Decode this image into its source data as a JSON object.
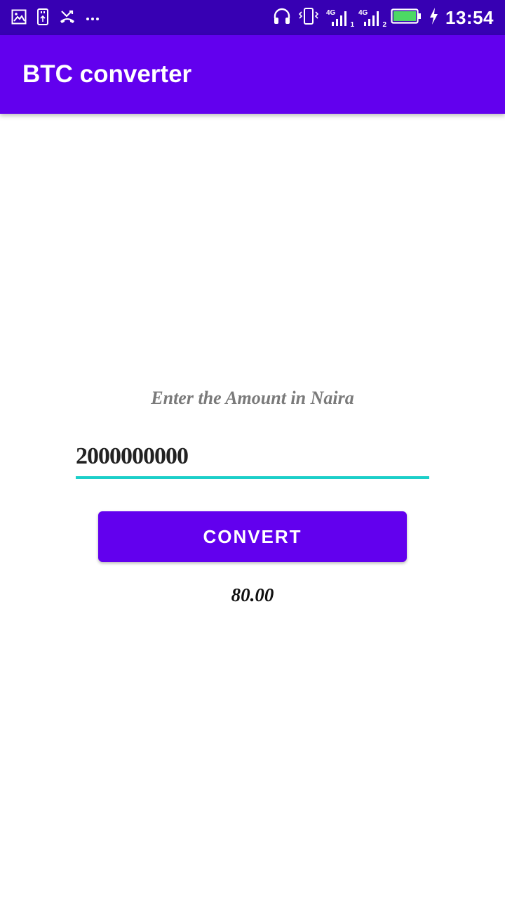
{
  "status_bar": {
    "time": "13:54",
    "network_1": {
      "type": "4G",
      "sim": "1"
    },
    "network_2": {
      "type": "4G",
      "sim": "2"
    },
    "icons": [
      "image-icon",
      "usb-icon",
      "missed-call-icon",
      "more-icon",
      "headset-icon",
      "vibrate-icon",
      "signal-icon",
      "battery-icon",
      "charging-icon"
    ],
    "battery_level": 1.0,
    "battery_color": "#4cd964"
  },
  "app_bar": {
    "title": "BTC converter",
    "background": "#6200ee"
  },
  "main": {
    "prompt_label": "Enter the Amount in Naira",
    "amount_value": "2000000000",
    "convert_label": "CONVERT",
    "result_text": "80.00"
  },
  "colors": {
    "status_bar": "#3700b3",
    "primary": "#6200ee",
    "accent_underline": "#1ccfc9"
  }
}
